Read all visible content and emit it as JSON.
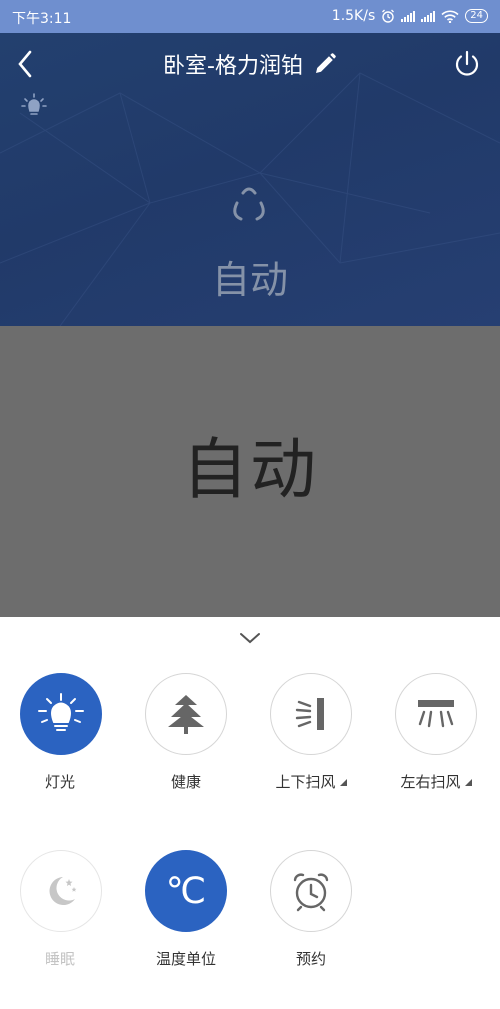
{
  "status_bar": {
    "time": "下午3:11",
    "net_speed": "1.5K/s",
    "battery": "24"
  },
  "header": {
    "title": "卧室-格力润铂",
    "icons": [
      "back-icon",
      "edit-pencil-icon",
      "power-icon",
      "light-bulb-icon"
    ]
  },
  "hero": {
    "mode_label": "自动",
    "mode_icon": "auto-mode-icon"
  },
  "overlay": {
    "mode_text": "自动"
  },
  "controls": {
    "collapse_icon": "chevron-down-icon",
    "buttons": [
      {
        "label": "灯光",
        "icon": "light-icon",
        "active": true
      },
      {
        "label": "健康",
        "icon": "health-tree-icon",
        "active": false
      },
      {
        "label": "上下扫风",
        "icon": "vertical-swing-icon",
        "active": false
      },
      {
        "label": "左右扫风",
        "icon": "horizontal-swing-icon",
        "active": false
      },
      {
        "label": "睡眠",
        "icon": "sleep-moon-icon",
        "active": false,
        "disabled": true
      },
      {
        "label": "温度单位",
        "icon": "celsius-icon",
        "active": true,
        "unit": "℃"
      },
      {
        "label": "预约",
        "icon": "alarm-clock-icon",
        "active": false
      }
    ]
  },
  "colors": {
    "accent": "#2b63c1",
    "header_bg": "#23406f",
    "status_bar_bg": "#6f8fcf",
    "overlay": "#6d6d6d"
  }
}
